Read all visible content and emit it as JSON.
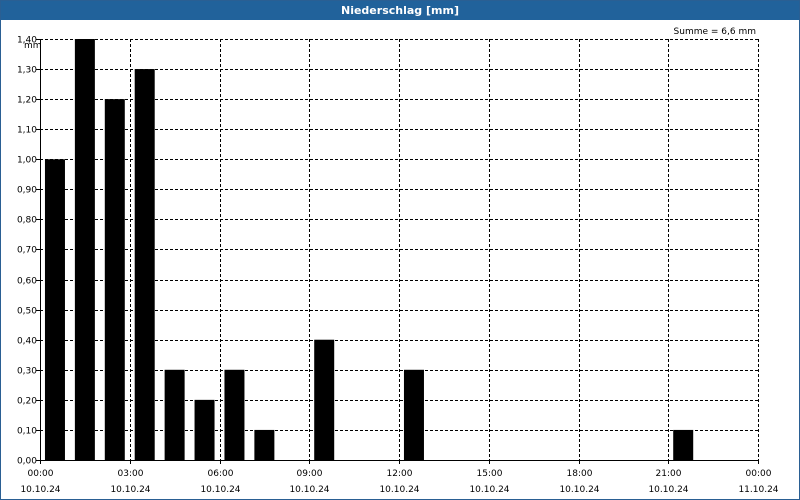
{
  "title": "Niederschlag [mm]",
  "summary": "Summe = 6,6 mm",
  "colors": {
    "titlebar": "#21629b",
    "bar": "#000000",
    "grid": "#000000"
  },
  "chart_data": {
    "type": "bar",
    "title": "Niederschlag [mm]",
    "ylabel": "mm",
    "xlabel": "",
    "ylim": [
      0,
      1.4
    ],
    "grid": true,
    "yticks": [
      "0,00",
      "0,10",
      "0,20",
      "0,30",
      "0,40",
      "0,50",
      "0,60",
      "0,70",
      "0,80",
      "0,90",
      "1,00",
      "1,10",
      "1,20",
      "1,30",
      "1,40"
    ],
    "xticks": [
      {
        "time": "00:00",
        "date": "10.10.24"
      },
      {
        "time": "03:00",
        "date": "10.10.24"
      },
      {
        "time": "06:00",
        "date": "10.10.24"
      },
      {
        "time": "09:00",
        "date": "10.10.24"
      },
      {
        "time": "12:00",
        "date": "10.10.24"
      },
      {
        "time": "15:00",
        "date": "10.10.24"
      },
      {
        "time": "18:00",
        "date": "10.10.24"
      },
      {
        "time": "21:00",
        "date": "10.10.24"
      },
      {
        "time": "00:00",
        "date": "11.10.24"
      }
    ],
    "hours": [
      0,
      1,
      2,
      3,
      4,
      5,
      6,
      7,
      8,
      9,
      10,
      11,
      12,
      13,
      14,
      15,
      16,
      17,
      18,
      19,
      20,
      21,
      22,
      23
    ],
    "values": [
      1.0,
      1.4,
      1.2,
      1.3,
      0.3,
      0.2,
      0.3,
      0.1,
      0,
      0.4,
      0,
      0,
      0.3,
      0,
      0,
      0,
      0,
      0,
      0,
      0,
      0,
      0.1,
      0,
      0
    ]
  }
}
